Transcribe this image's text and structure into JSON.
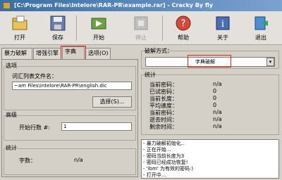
{
  "title": "[C:\\Program Files\\Intelore\\RAR-PR\\example.rar] - Cracky By fly",
  "toolbar": {
    "open": "打开",
    "save": "保存",
    "start": "开始",
    "stop": "停止",
    "help": "帮助",
    "about": "关于",
    "exit": "退出"
  },
  "tabs": [
    "暴力破解",
    "增强引擎",
    "字典",
    "选项(O)"
  ],
  "options_group": "选项",
  "wordlist_label": "词汇列表文件名：",
  "wordlist_path": "~am Files\\Intelore\\RAR-PR\\english.dic",
  "select_button": "选择(S)...",
  "advanced_group": "高级",
  "start_line_label": "开始行数 #:",
  "start_line_value": "1",
  "stats_left_group": "统计",
  "words_label": "字数：",
  "words_value": "n/a",
  "crack_mode_group": "破解方式：",
  "crack_mode_value": "字典破解",
  "stats_right_group": "统计",
  "stats": [
    {
      "k": "当前密码：",
      "v": "n/a"
    },
    {
      "k": "已试密码：",
      "v": "0"
    },
    {
      "k": "当前长度：",
      "v": "0"
    },
    {
      "k": "平均速度：",
      "v": "0"
    },
    {
      "k": "当前密码：",
      "v": "n/a"
    },
    {
      "k": "逝去时间：",
      "v": "n/a"
    },
    {
      "k": "剩余时间：",
      "v": "n/a"
    }
  ],
  "log": [
    "- 暴力破解初始化..",
    "- 正在开始...",
    "- 密码当前长度为3",
    "- 密码已经成功恢复!",
    "- 'ibm' 为有效的密码:)",
    "- 打开中..."
  ]
}
